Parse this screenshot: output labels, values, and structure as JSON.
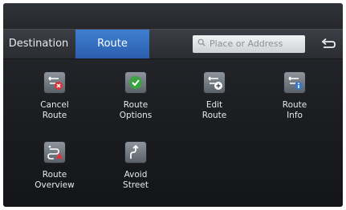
{
  "tabs": {
    "destination": "Destination",
    "route": "Route"
  },
  "search": {
    "placeholder": "Place or Address"
  },
  "menu": [
    {
      "label": "Cancel\nRoute",
      "icon": "cancel-route-icon"
    },
    {
      "label": "Route\nOptions",
      "icon": "route-options-icon"
    },
    {
      "label": "Edit\nRoute",
      "icon": "edit-route-icon"
    },
    {
      "label": "Route\nInfo",
      "icon": "route-info-icon"
    },
    {
      "label": "Route\nOverview",
      "icon": "route-overview-icon"
    },
    {
      "label": "Avoid\nStreet",
      "icon": "avoid-street-icon"
    }
  ],
  "colors": {
    "accent": "#2f6cc0",
    "cancel": "#d9343b",
    "confirm": "#3aa33f",
    "info": "#3b78c9"
  }
}
